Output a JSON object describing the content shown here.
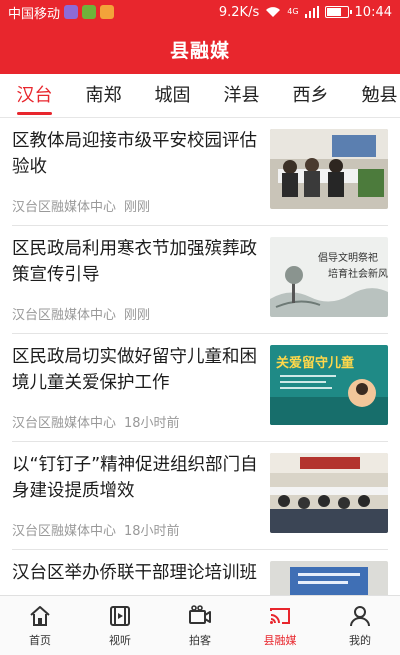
{
  "status_bar": {
    "carrier": "中国移动",
    "speed": "9.2K/s",
    "network": "4G",
    "time": "10:44"
  },
  "header": {
    "title": "县融媒"
  },
  "tabs": [
    {
      "label": "汉台",
      "active": true
    },
    {
      "label": "南郑",
      "active": false
    },
    {
      "label": "城固",
      "active": false
    },
    {
      "label": "洋县",
      "active": false
    },
    {
      "label": "西乡",
      "active": false
    },
    {
      "label": "勉县",
      "active": false
    }
  ],
  "news": [
    {
      "title": "区教体局迎接市级平安校园评估验收",
      "source": "汉台区融媒体中心",
      "time": "刚刚",
      "thumb_icon": "meeting-photo"
    },
    {
      "title": "区民政局利用寒衣节加强殡葬政策宣传引导",
      "source": "汉台区融媒体中心",
      "time": "刚刚",
      "thumb_icon": "poster-ink-painting",
      "thumb_text": [
        "倡导文明祭祀",
        "培育社会新风"
      ]
    },
    {
      "title": "区民政局切实做好留守儿童和困境儿童关爱保护工作",
      "source": "汉台区融媒体中心",
      "time": "18小时前",
      "thumb_icon": "poster-care",
      "thumb_text": [
        "关爱留守儿童"
      ]
    },
    {
      "title": "以“钉钉子”精神促进组织部门自身建设提质增效",
      "source": "汉台区融媒体中心",
      "time": "18小时前",
      "thumb_icon": "meeting-hall-photo"
    },
    {
      "title": "汉台区举办侨联干部理论培训班",
      "source": "",
      "time": "",
      "thumb_icon": "training-photo"
    }
  ],
  "bottom_nav": [
    {
      "label": "首页",
      "icon": "home-icon",
      "active": false
    },
    {
      "label": "视听",
      "icon": "film-icon",
      "active": false
    },
    {
      "label": "拍客",
      "icon": "camera-icon",
      "active": false
    },
    {
      "label": "县融媒",
      "icon": "cast-icon",
      "active": true
    },
    {
      "label": "我的",
      "icon": "person-icon",
      "active": false
    }
  ],
  "colors": {
    "brand": "#e8262d",
    "meta": "#999999"
  }
}
